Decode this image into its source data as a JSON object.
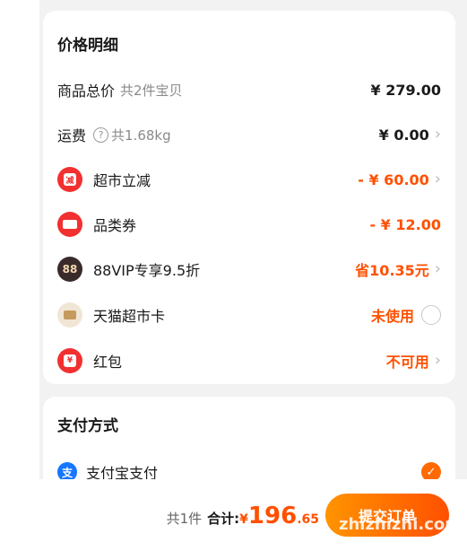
{
  "price_detail": {
    "title": "价格明细",
    "rows": [
      {
        "label": "商品总价",
        "sub": "共2件宝贝",
        "value": "¥ 279.00"
      },
      {
        "label": "运费",
        "help_icon": "question-circle-icon",
        "sub": "共1.68kg",
        "value": "¥ 0.00"
      },
      {
        "label": "超市立减",
        "icon": "discount-icon",
        "icon_text": "减",
        "value": "- ¥ 60.00"
      },
      {
        "label": "品类券",
        "icon": "coupon-icon",
        "value": "- ¥ 12.00"
      },
      {
        "label": "88VIP专享9.5折",
        "icon": "vip88-icon",
        "icon_text": "88",
        "value": "省10.35元"
      },
      {
        "label": "天猫超市卡",
        "icon": "wallet-card-icon",
        "value": "未使用"
      },
      {
        "label": "红包",
        "icon": "red-packet-icon",
        "icon_text": "¥",
        "value": "不可用"
      }
    ]
  },
  "payment": {
    "title": "支付方式",
    "method": "支付宝支付",
    "icon_text": "支",
    "selected": true
  },
  "footer": {
    "count": "共1件",
    "total_label": "合计:",
    "currency": "¥",
    "amount_int": "196",
    "amount_dec": ".65",
    "submit_label": "提交订单",
    "watermark": "zhizhizhi.com"
  },
  "colors": {
    "accent": "#ff5000",
    "red_badge": "#f23030",
    "alipay": "#1677ff"
  }
}
